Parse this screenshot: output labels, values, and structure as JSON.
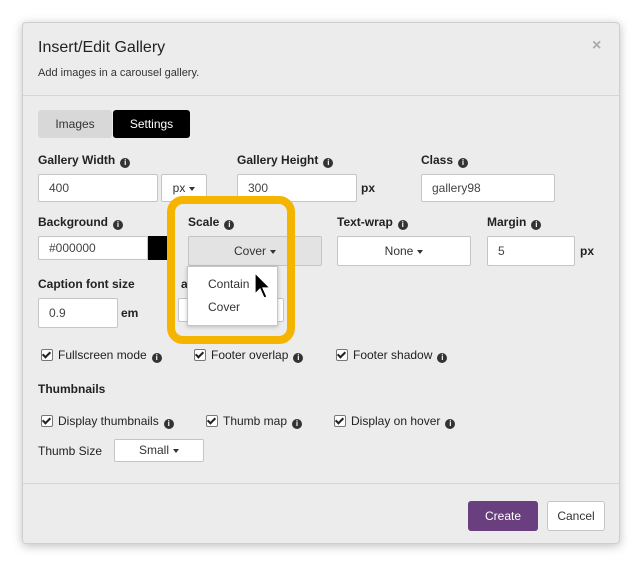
{
  "dialog": {
    "title": "Insert/Edit Gallery",
    "subtitle": "Add images in a carousel gallery.",
    "close_glyph": "×"
  },
  "tabs": [
    {
      "label": "Images",
      "active": false
    },
    {
      "label": "Settings",
      "active": true
    }
  ],
  "fields": {
    "gallery_width": {
      "label": "Gallery Width",
      "value": "400",
      "unit": "px"
    },
    "gallery_height": {
      "label": "Gallery Height",
      "value": "300",
      "unit": "px"
    },
    "class": {
      "label": "Class",
      "placeholder": "gallery98"
    },
    "background": {
      "label": "Background",
      "value": "#000000",
      "swatch_color": "#000000"
    },
    "scale": {
      "label": "Scale",
      "selected": "Cover",
      "options": [
        "Contain",
        "Cover"
      ]
    },
    "text_wrap": {
      "label": "Text-wrap",
      "selected": "None"
    },
    "margin": {
      "label": "Margin",
      "value": "5",
      "unit": "px"
    },
    "caption_font_size": {
      "label": "Caption font size",
      "value": "0.9",
      "unit": "em"
    },
    "partial_hidden": {
      "label_fragment": "a",
      "value_fragment": "#"
    }
  },
  "checkboxes_row1": [
    {
      "label": "Fullscreen mode",
      "checked": true
    },
    {
      "label": "Footer overlap",
      "checked": true
    },
    {
      "label": "Footer shadow",
      "checked": true
    }
  ],
  "thumbnails": {
    "heading": "Thumbnails",
    "checkboxes": [
      {
        "label": "Display thumbnails",
        "checked": true
      },
      {
        "label": "Thumb map",
        "checked": true
      },
      {
        "label": "Display on hover",
        "checked": true
      }
    ],
    "thumb_size": {
      "label": "Thumb Size",
      "selected": "Small"
    }
  },
  "footer": {
    "create": "Create",
    "cancel": "Cancel"
  },
  "colors": {
    "accent": "#6a3f7f",
    "highlight": "#f4b400",
    "active_tab": "#000000"
  },
  "icons": [
    "info-icon",
    "caret-down-icon",
    "check-icon",
    "close-icon",
    "mouse-cursor-icon"
  ]
}
